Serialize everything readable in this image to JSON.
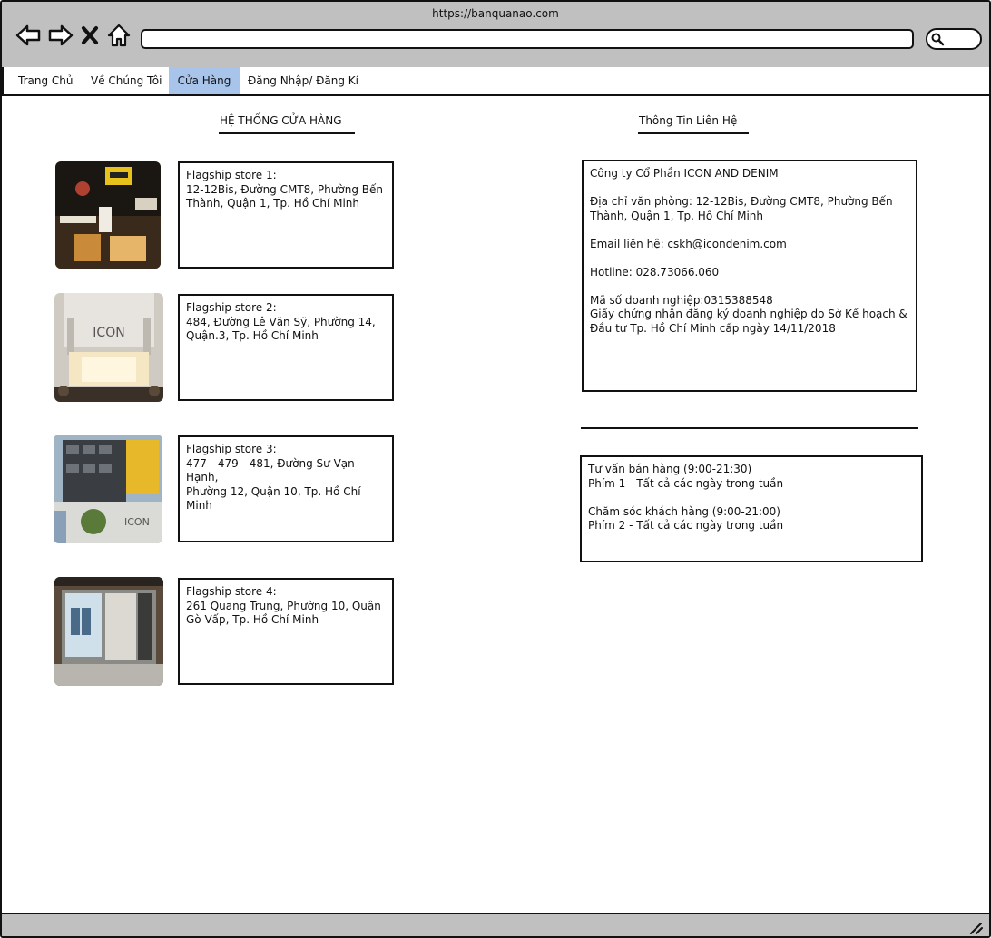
{
  "browser": {
    "url": "https://banquanao.com"
  },
  "menu": {
    "items": [
      "Trang Chủ",
      "Về Chúng Tôi",
      "Cửa Hàng",
      "Đăng Nhập/ Đăng Kí"
    ],
    "active_index": 2
  },
  "stores_section": {
    "title": "HỆ THỐNG CỬA HÀNG",
    "stores": [
      {
        "name": "Flagship store 1:",
        "address_l1": "12-12Bis, Đường CMT8, Phường Bến",
        "address_l2": "Thành, Quận 1, Tp. Hồ Chí Minh"
      },
      {
        "name": "Flagship store 2:",
        "address_l1": "484, Đường Lê Văn Sỹ, Phường 14,",
        "address_l2": "Quận.3, Tp. Hồ Chí Minh"
      },
      {
        "name": "Flagship store 3:",
        "address_l1": "477 - 479 - 481, Đường Sư Vạn Hạnh,",
        "address_l2": "Phường 12, Quận 10, Tp. Hồ Chí Minh"
      },
      {
        "name": "Flagship store 4:",
        "address_l1": "261 Quang Trung, Phường 10, Quận",
        "address_l2": "Gò Vấp, Tp. Hồ Chí Minh"
      }
    ]
  },
  "contact_section": {
    "title": "Thông Tin Liên Hệ",
    "company": "Công ty Cổ Phần ICON AND DENIM",
    "address_l1": "Địa chỉ văn phòng: 12-12Bis, Đường CMT8, Phường Bến",
    "address_l2": "Thành, Quận 1, Tp. Hồ Chí Minh",
    "email": "Email liên hệ: cskh@icondenim.com",
    "hotline": "Hotline: 028.73066.060",
    "tax_code": "Mã số doanh nghiệp:0315388548",
    "license_l1": "Giấy chứng nhận đăng ký doanh nghiệp do Sở Kế hoạch &",
    "license_l2": "Đầu tư Tp. Hồ Chí Minh cấp ngày 14/11/2018"
  },
  "support": {
    "sales_title": "Tư vấn bán hàng (9:00-21:30)",
    "sales_key": "Phím 1 - Tất cả các ngày trong tuần",
    "care_title": "Chăm sóc khách hàng (9:00-21:00)",
    "care_key": "Phím 2 - Tất cả các ngày trong tuần"
  },
  "colors": {
    "chrome": "#c0c0c0",
    "active_tab": "#a9c4eb",
    "border": "#111111"
  }
}
